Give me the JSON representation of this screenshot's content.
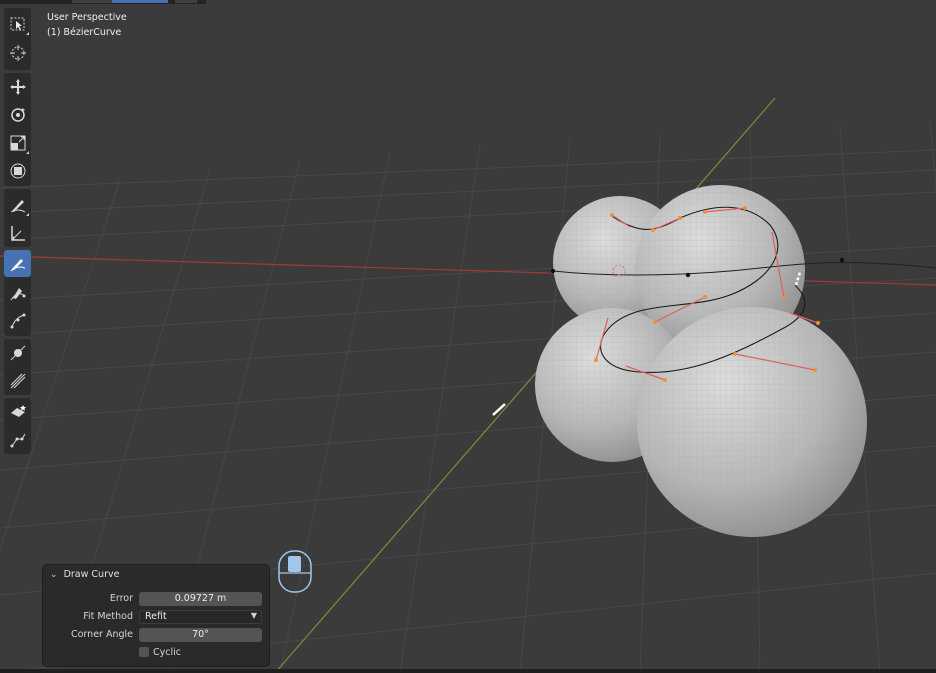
{
  "viewport": {
    "view_title": "User Perspective",
    "object_name": "(1) BézierCurve"
  },
  "toolbar": {
    "tools": [
      {
        "name": "select-box-tool",
        "icon": "select-box-icon",
        "active": false
      },
      {
        "name": "cursor-tool",
        "icon": "cursor-icon",
        "active": false
      },
      {
        "name": "move-tool",
        "icon": "move-icon",
        "active": false
      },
      {
        "name": "rotate-tool",
        "icon": "rotate-icon",
        "active": false
      },
      {
        "name": "scale-tool",
        "icon": "scale-icon",
        "active": false
      },
      {
        "name": "transform-tool",
        "icon": "transform-icon",
        "active": false
      },
      {
        "name": "annotate-tool",
        "icon": "annotate-icon",
        "active": false
      },
      {
        "name": "measure-tool",
        "icon": "measure-icon",
        "active": false
      },
      {
        "name": "draw-tool",
        "icon": "draw-curve-icon",
        "active": true
      },
      {
        "name": "pen-tool",
        "icon": "pen-icon",
        "active": false
      },
      {
        "name": "extrude-tool",
        "icon": "extrude-icon",
        "active": false
      },
      {
        "name": "radius-tool",
        "icon": "radius-icon",
        "active": false
      },
      {
        "name": "tilt-tool",
        "icon": "tilt-icon",
        "active": false
      },
      {
        "name": "randomize-tool",
        "icon": "randomize-icon",
        "active": false
      },
      {
        "name": "add-shape-tool",
        "icon": "add-shape-icon",
        "active": false
      }
    ]
  },
  "redo_panel": {
    "title": "Draw Curve",
    "collapse_icon": "chevron-down-icon",
    "rows": {
      "error": {
        "label": "Error",
        "value": "0.09727 m"
      },
      "fit_method": {
        "label": "Fit Method",
        "value": "Refit"
      },
      "corner_angle": {
        "label": "Corner Angle",
        "value": "70°"
      },
      "cyclic": {
        "label": "Cyclic",
        "checked": false
      }
    }
  },
  "mouse_hint": {
    "icon": "mouse-left-button-icon"
  },
  "colors": {
    "accent": "#4772b3",
    "x_axis": "#a03a3a",
    "y_axis": "#7f8a3a",
    "handle_orange": "#f0903a",
    "handle_red": "#e0605a",
    "mesh": "#c9c9c9"
  }
}
